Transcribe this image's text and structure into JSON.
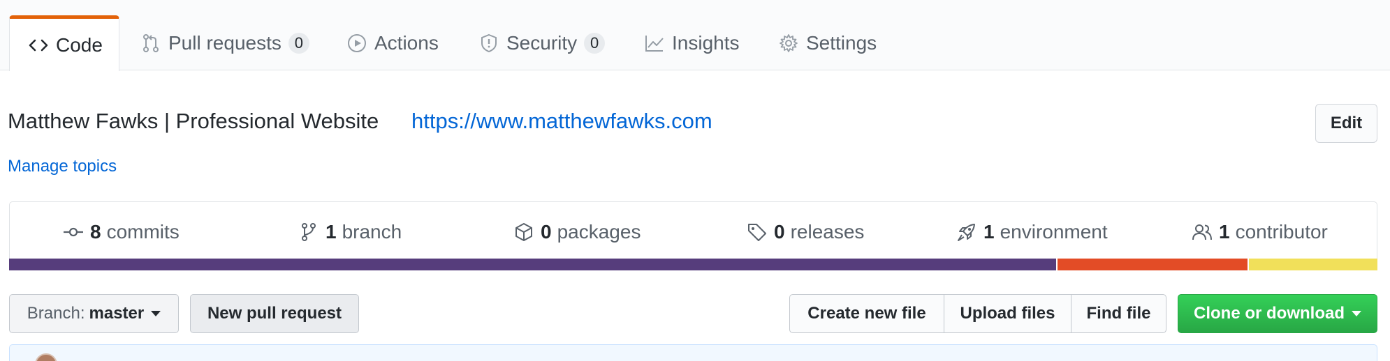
{
  "tabs": [
    {
      "label": "Code",
      "icon": "code-icon",
      "active": true
    },
    {
      "label": "Pull requests",
      "icon": "git-pull-request-icon",
      "counter": "0"
    },
    {
      "label": "Actions",
      "icon": "play-icon"
    },
    {
      "label": "Security",
      "icon": "shield-icon",
      "counter": "0"
    },
    {
      "label": "Insights",
      "icon": "graph-icon"
    },
    {
      "label": "Settings",
      "icon": "gear-icon"
    }
  ],
  "repo": {
    "description": "Matthew Fawks | Professional Website",
    "homepage": "https://www.matthewfawks.com",
    "manage_topics": "Manage topics",
    "edit_label": "Edit"
  },
  "summary": [
    {
      "count": "8",
      "label": "commits",
      "icon": "commit-icon"
    },
    {
      "count": "1",
      "label": "branch",
      "icon": "git-branch-icon"
    },
    {
      "count": "0",
      "label": "packages",
      "icon": "package-icon"
    },
    {
      "count": "0",
      "label": "releases",
      "icon": "tag-icon"
    },
    {
      "count": "1",
      "label": "environment",
      "icon": "rocket-icon"
    },
    {
      "count": "1",
      "label": "contributor",
      "icon": "people-icon"
    }
  ],
  "languages": [
    {
      "color": "#563d7c",
      "percent": 76.6
    },
    {
      "color": "#e34c26",
      "percent": 14.0
    },
    {
      "color": "#f1e05a",
      "percent": 9.4
    }
  ],
  "file_nav": {
    "branch_prefix": "Branch:",
    "branch_name": "master",
    "new_pr": "New pull request",
    "create_file": "Create new file",
    "upload_files": "Upload files",
    "find_file": "Find file",
    "clone": "Clone or download"
  },
  "colors": {
    "accent_tab": "#e36209",
    "link": "#0366d6",
    "clone_green": "#2ea44f"
  }
}
